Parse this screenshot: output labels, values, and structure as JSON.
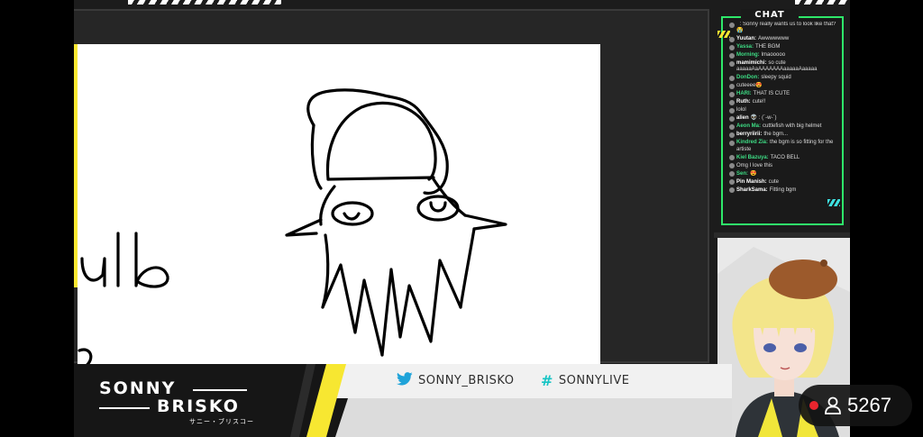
{
  "stream": {
    "canvas_text": "ulb",
    "canvas_text_fragment": "a"
  },
  "chat": {
    "title": "CHAT",
    "messages": [
      {
        "user": "",
        "text": "´ : Sonny really wants us to look like that? 😭",
        "green": false
      },
      {
        "user": "Yuutan:",
        "text": "Awwwwwww",
        "green": false
      },
      {
        "user": "Yassa:",
        "text": "THE BGM",
        "green": true
      },
      {
        "user": "Morning:",
        "text": "lmaooooo",
        "green": true
      },
      {
        "user": "mamimichi:",
        "text": "so cute aaaaaAaAAAAAAAaaaaaAaaaaa",
        "green": false
      },
      {
        "user": "DonDon:",
        "text": "sleepy squid",
        "green": true
      },
      {
        "user": "",
        "text": "cuteeee😍",
        "green": true
      },
      {
        "user": "HARI:",
        "text": "THAT IS CUTE",
        "green": true
      },
      {
        "user": "Ruth:",
        "text": "cute!!",
        "green": false
      },
      {
        "user": "",
        "text": "lolol",
        "green": true
      },
      {
        "user": "alien",
        "text": "👽 : (´-w-`)",
        "green": false
      },
      {
        "user": "Aeon Ma:",
        "text": "cuttlefish with big helmet",
        "green": true
      },
      {
        "user": "berryriirii:",
        "text": "the bgm...",
        "green": false
      },
      {
        "user": "Kindred Zia:",
        "text": "the bgm is so fitting for the artiste",
        "green": true
      },
      {
        "user": "Kiel Bazuya:",
        "text": "TACO BELL",
        "green": true
      },
      {
        "user": "",
        "text": "Omg I love this",
        "green": false
      },
      {
        "user": "Sen:",
        "text": "😍",
        "green": true
      },
      {
        "user": "Pin Manish:",
        "text": "cute",
        "green": false
      },
      {
        "user": "SharkSama:",
        "text": "Fitting bgm",
        "green": false
      }
    ]
  },
  "branding": {
    "name_line1": "SONNY",
    "name_line2": "BRISKO",
    "name_sub": "サニー・ブリスコー",
    "twitter_handle": "SONNY_BRISKO",
    "hashtag": "SONNYLIVE"
  },
  "viewers": {
    "count": "5267",
    "live_color": "#e8252e"
  },
  "colors": {
    "accent_yellow": "#f7e731",
    "accent_green": "#2ee86a",
    "accent_cyan": "#3ee0e0"
  },
  "icons": {
    "twitter": "bird-icon",
    "hashtag": "hashtag-icon",
    "viewer": "person-icon"
  }
}
